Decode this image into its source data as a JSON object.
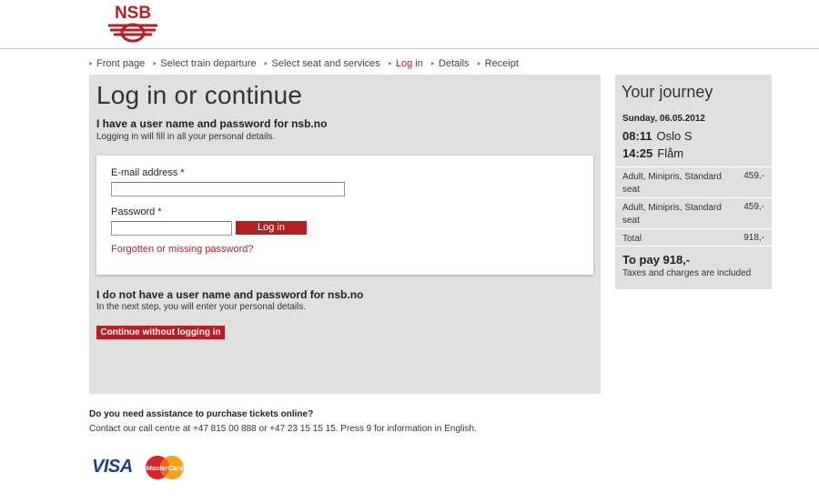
{
  "brand": {
    "name": "NSB",
    "color": "#b41f24"
  },
  "breadcrumb": [
    {
      "label": "Front page",
      "active": false
    },
    {
      "label": "Select train departure",
      "active": false
    },
    {
      "label": "Select seat and services",
      "active": false
    },
    {
      "label": "Log in",
      "active": true
    },
    {
      "label": "Details",
      "active": false
    },
    {
      "label": "Receipt",
      "active": false
    }
  ],
  "main": {
    "title": "Log in or continue",
    "has_account": {
      "heading": "I have a user name and password for nsb.no",
      "text": "Logging in will fill in all your personal details."
    },
    "login": {
      "email_label": "E-mail address *",
      "email_value": "",
      "password_label": "Password *",
      "password_value": "",
      "login_button": "Log in",
      "forgot_link": "Forgotten or missing password?"
    },
    "no_account": {
      "heading": "I do not have a user name and password for nsb.no",
      "text": "In the next step, you will enter your personal details.",
      "continue_button": "Continue without logging in"
    }
  },
  "journey": {
    "title": "Your journey",
    "date": "Sunday, 06.05.2012",
    "departure": {
      "time": "08:11",
      "station": "Oslo S"
    },
    "arrival": {
      "time": "14:25",
      "station": "Flåm"
    },
    "items": [
      {
        "desc": "Adult, Minipris, Standard seat",
        "price": "459,-"
      },
      {
        "desc": "Adult, Minipris, Standard seat",
        "price": "459,-"
      }
    ],
    "total_label": "Total",
    "total_value": "918,-",
    "to_pay": "To pay 918,-",
    "taxes_note": "Taxes and charges are included"
  },
  "assistance": {
    "heading": "Do you need assistance to purchase tickets online?",
    "text": "Contact our call centre at +47 815 00 888 or +47 23 15 15 15. Press 9 for information in English."
  },
  "payment": {
    "visa": "VISA",
    "mastercard": "MasterCard"
  }
}
